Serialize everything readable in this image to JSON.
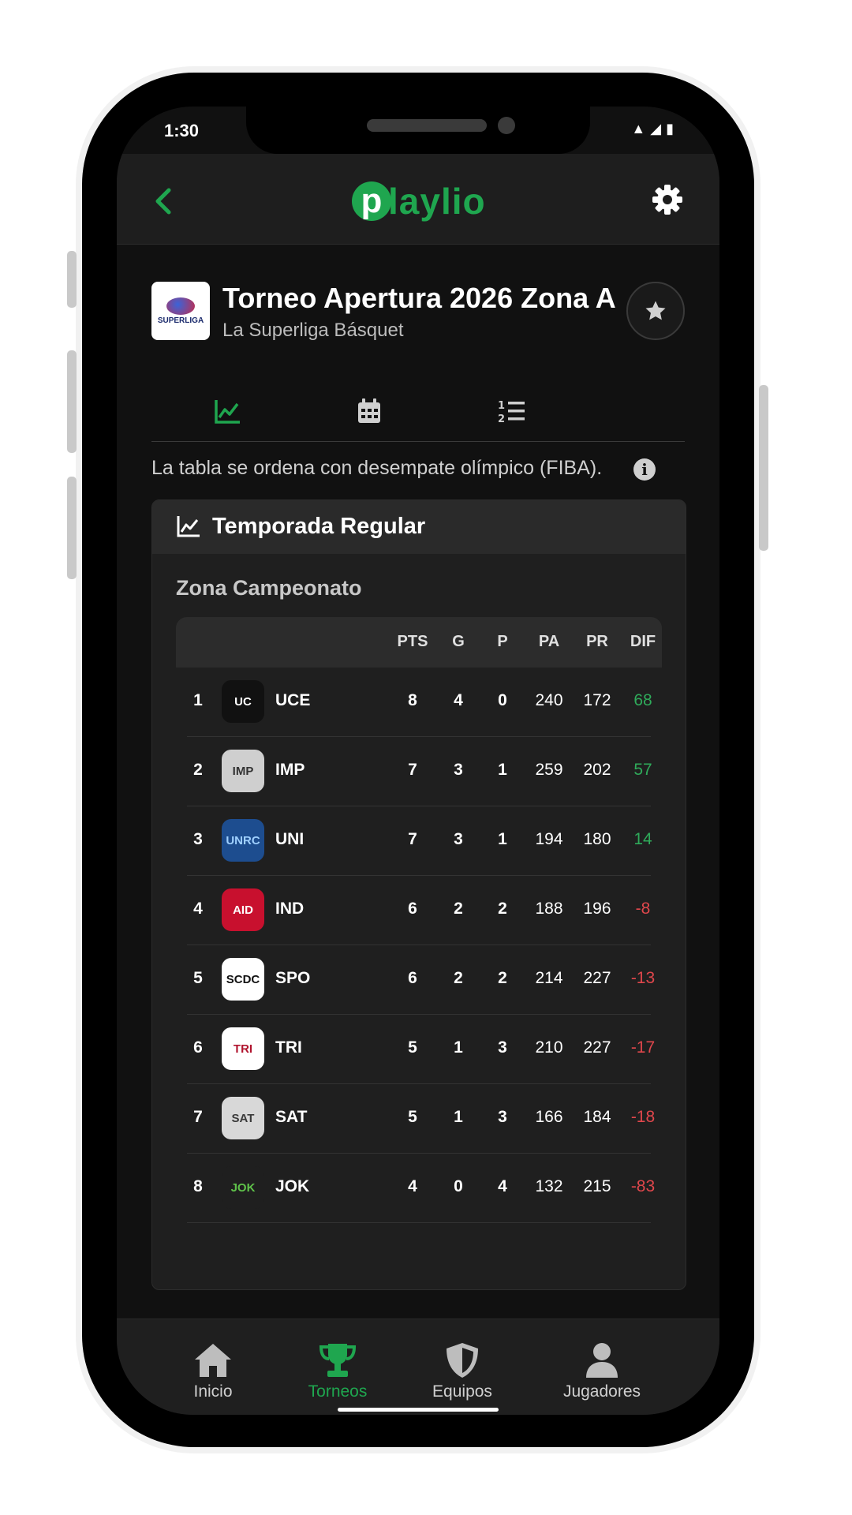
{
  "status_bar": {
    "time": "1:30"
  },
  "app": {
    "logo_letter": "p",
    "logo_text": "laylio",
    "accent": "#1fa64f"
  },
  "tournament": {
    "title": "Torneo Apertura 2026 Zona A",
    "subtitle": "La Superliga Básquet",
    "logo_text": "SUPERLIGA"
  },
  "tabs": [
    {
      "name": "chart-icon",
      "active": true
    },
    {
      "name": "calendar-icon",
      "active": false
    },
    {
      "name": "ordered-list-icon",
      "active": false
    }
  ],
  "note": "La tabla se ordena con desempate olímpico (FIBA).",
  "info_glyph": "i",
  "card": {
    "title": "Temporada Regular",
    "zone": "Zona Campeonato"
  },
  "columns": [
    "PTS",
    "G",
    "P",
    "PA",
    "PR",
    "DIF"
  ],
  "rows": [
    {
      "pos": "1",
      "abbr": "UCE",
      "pts": "8",
      "g": "4",
      "p": "0",
      "pa": "240",
      "pr": "172",
      "dif": "68"
    },
    {
      "pos": "2",
      "abbr": "IMP",
      "pts": "7",
      "g": "3",
      "p": "1",
      "pa": "259",
      "pr": "202",
      "dif": "57"
    },
    {
      "pos": "3",
      "abbr": "UNI",
      "pts": "7",
      "g": "3",
      "p": "1",
      "pa": "194",
      "pr": "180",
      "dif": "14"
    },
    {
      "pos": "4",
      "abbr": "IND",
      "pts": "6",
      "g": "2",
      "p": "2",
      "pa": "188",
      "pr": "196",
      "dif": "-8"
    },
    {
      "pos": "5",
      "abbr": "SPO",
      "pts": "6",
      "g": "2",
      "p": "2",
      "pa": "214",
      "pr": "227",
      "dif": "-13"
    },
    {
      "pos": "6",
      "abbr": "TRI",
      "pts": "5",
      "g": "1",
      "p": "3",
      "pa": "210",
      "pr": "227",
      "dif": "-17"
    },
    {
      "pos": "7",
      "abbr": "SAT",
      "pts": "5",
      "g": "1",
      "p": "3",
      "pa": "166",
      "pr": "184",
      "dif": "-18"
    },
    {
      "pos": "8",
      "abbr": "JOK",
      "pts": "4",
      "g": "0",
      "p": "4",
      "pa": "132",
      "pr": "215",
      "dif": "-83"
    }
  ],
  "crests": [
    {
      "label": "UC",
      "bg": "#111111",
      "fg": "#ffffff"
    },
    {
      "label": "IMP",
      "bg": "#cfcfcf",
      "fg": "#333333"
    },
    {
      "label": "UNRC",
      "bg": "#1d4d8f",
      "fg": "#9fd0ff"
    },
    {
      "label": "AID",
      "bg": "#c8102e",
      "fg": "#ffffff"
    },
    {
      "label": "SCDC",
      "bg": "#ffffff",
      "fg": "#111111"
    },
    {
      "label": "TRI",
      "bg": "#ffffff",
      "fg": "#b0142e"
    },
    {
      "label": "SAT",
      "bg": "#d8d8d8",
      "fg": "#3a3a3a"
    },
    {
      "label": "JOK",
      "bg": "#1f1f1f",
      "fg": "#5fc24a"
    }
  ],
  "colors": {
    "positive": "#2faa5a",
    "negative": "#e0474c",
    "inactive": "#cfcfcf"
  },
  "bottom_nav": [
    {
      "label": "Inicio",
      "icon": "home-icon",
      "active": false
    },
    {
      "label": "Torneos",
      "icon": "trophy-icon",
      "active": true
    },
    {
      "label": "Equipos",
      "icon": "shield-icon",
      "active": false
    },
    {
      "label": "Jugadores",
      "icon": "user-icon",
      "active": false
    }
  ]
}
